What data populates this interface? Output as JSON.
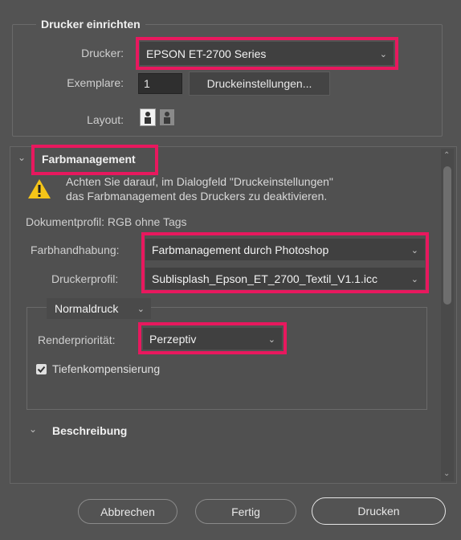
{
  "setup": {
    "title": "Drucker einrichten",
    "printer_label": "Drucker:",
    "printer_value": "EPSON ET-2700 Series",
    "copies_label": "Exemplare:",
    "copies_value": "1",
    "print_settings_button": "Druckeinstellungen...",
    "layout_label": "Layout:"
  },
  "color": {
    "title": "Farbmanagement",
    "warning_line1": "Achten Sie darauf, im Dialogfeld \"Druckeinstellungen\"",
    "warning_line2": "das Farbmanagement des Druckers zu deaktivieren.",
    "doc_profile": "Dokumentprofil: RGB ohne Tags",
    "handling_label": "Farbhandhabung:",
    "handling_value": "Farbmanagement durch Photoshop",
    "printer_profile_label": "Druckerprofil:",
    "printer_profile_value": "Sublisplash_Epson_ET_2700_Textil_V1.1.icc",
    "mode_value": "Normaldruck",
    "render_label": "Renderpriorität:",
    "render_value": "Perzeptiv",
    "bpc_label": "Tiefenkompensierung"
  },
  "description": {
    "title": "Beschreibung"
  },
  "footer": {
    "cancel": "Abbrechen",
    "done": "Fertig",
    "print": "Drucken"
  },
  "colors": {
    "highlight": "#e8185e",
    "background": "#535353",
    "field": "#404040"
  }
}
